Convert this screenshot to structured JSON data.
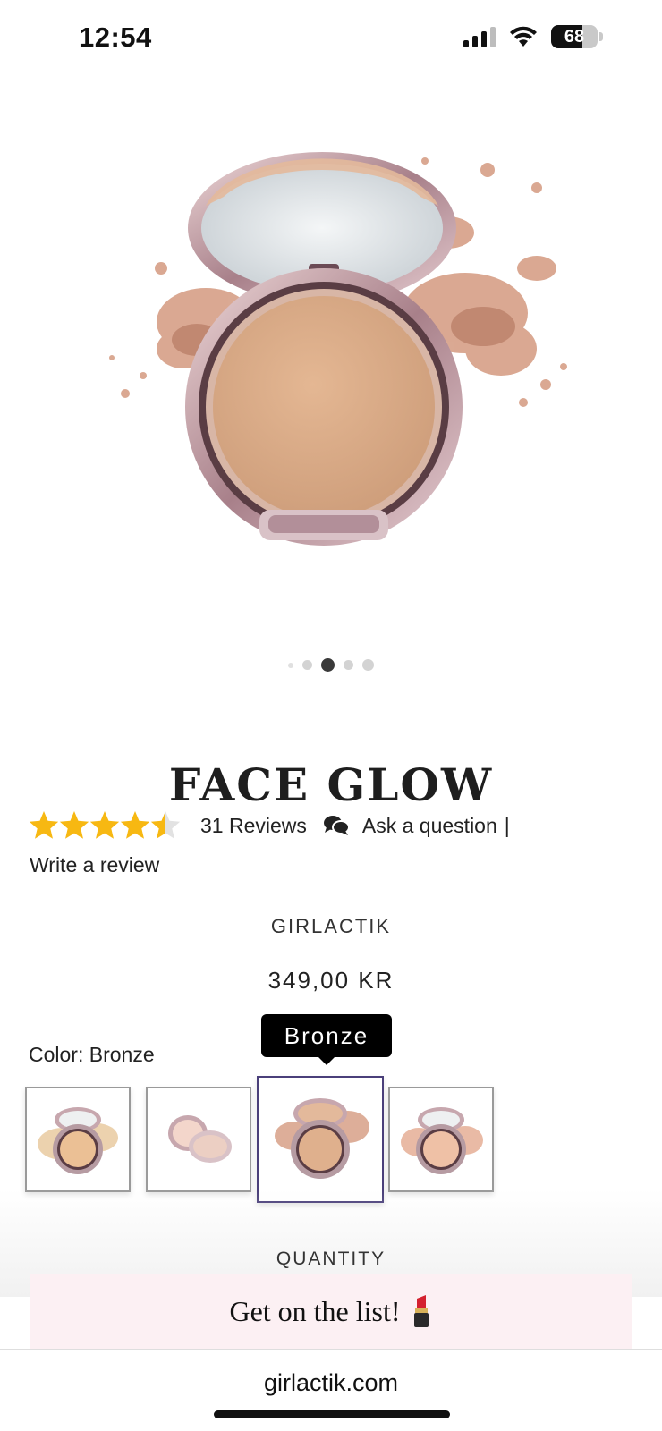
{
  "status_bar": {
    "time": "12:54",
    "battery_level": "68",
    "battery_fraction": 0.68,
    "icons": [
      "signal-icon",
      "wifi-icon",
      "battery-icon"
    ]
  },
  "gallery": {
    "image_alt": "compact-powder-icon",
    "dot_count": 5,
    "active_dot": 2
  },
  "product": {
    "title": "FACE GLOW",
    "rating": 4.5,
    "rating_max": 5,
    "star_color": "#F7B812",
    "reviews_label": "31 Reviews",
    "ask_label": "Ask a question",
    "separator": "|",
    "write_review_label": "Write a review",
    "brand": "GIRLACTIK",
    "price": "349,00 KR"
  },
  "color_selector": {
    "label": "Color: Bronze",
    "tooltip": "Bronze",
    "selected_index": 2,
    "swatches": [
      {
        "name": "swatch-1"
      },
      {
        "name": "swatch-2"
      },
      {
        "name": "swatch-3"
      },
      {
        "name": "swatch-4"
      }
    ]
  },
  "quantity_label": "QUANTITY",
  "signup": {
    "text": "Get on the list!",
    "icon": "lipstick-icon"
  },
  "browser": {
    "url": "girlactik.com"
  }
}
